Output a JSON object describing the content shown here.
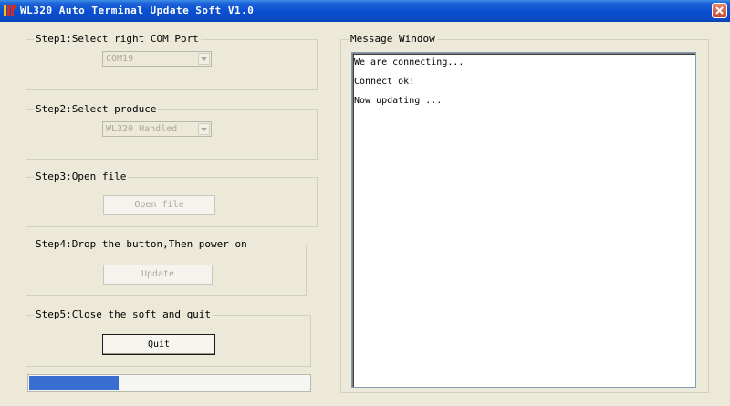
{
  "window": {
    "title": "WL320 Auto Terminal Update Soft  V1.0"
  },
  "steps": {
    "step1": {
      "label": "Step1:Select right COM Port",
      "combo_value": "COM19"
    },
    "step2": {
      "label": "Step2:Select produce",
      "combo_value": "WL320 Handled"
    },
    "step3": {
      "label": "Step3:Open file",
      "button_label": "Open file"
    },
    "step4": {
      "label": "Step4:Drop the button,Then power on",
      "button_label": "Update"
    },
    "step5": {
      "label": "Step5:Close the soft and quit",
      "button_label": "Quit"
    }
  },
  "progress": {
    "fraction": 0.32,
    "color": "#3a6ed3"
  },
  "message_window": {
    "label": "Message Window",
    "lines": [
      "We are connecting...",
      "Connect ok!",
      "Now updating ..."
    ]
  },
  "icons": {
    "app": "app-logo-icon",
    "close": "close-icon",
    "dropdown": "chevron-down-icon"
  },
  "colors": {
    "titlebar": "#0a4fd0",
    "close_button": "#c9462a",
    "background": "#ece9d8"
  }
}
